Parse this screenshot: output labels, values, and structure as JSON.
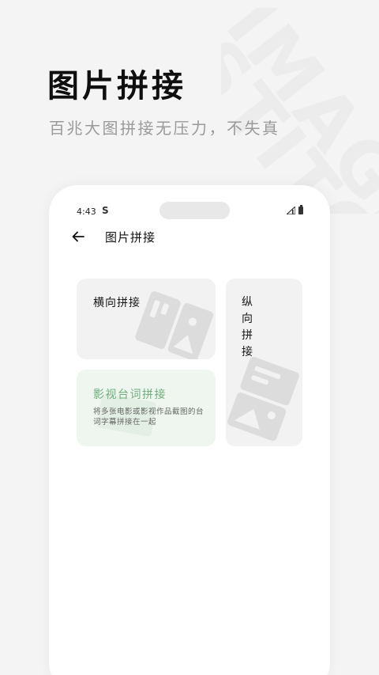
{
  "watermark": {
    "line1": "IMAGE",
    "line2": "STITCH"
  },
  "hero": {
    "title": "图片拼接",
    "subtitle": "百兆大图拼接无压力，不失真"
  },
  "phone": {
    "status_bar": {
      "time": "4:43",
      "app_indicator": "S"
    },
    "app_bar": {
      "title": "图片拼接",
      "back_icon": "arrow-left-icon"
    },
    "cards": {
      "horizontal": {
        "label": "横向拼接",
        "icon": "horizontal-stitch-illustration"
      },
      "vertical": {
        "label": "纵向拼接",
        "icon": "vertical-stitch-illustration"
      },
      "subtitle_stitch": {
        "label": "影视台词拼接",
        "description": "将多张电影或影视作品截图的台词字幕拼接在一起",
        "accent_color": "#6fae7c"
      }
    }
  }
}
